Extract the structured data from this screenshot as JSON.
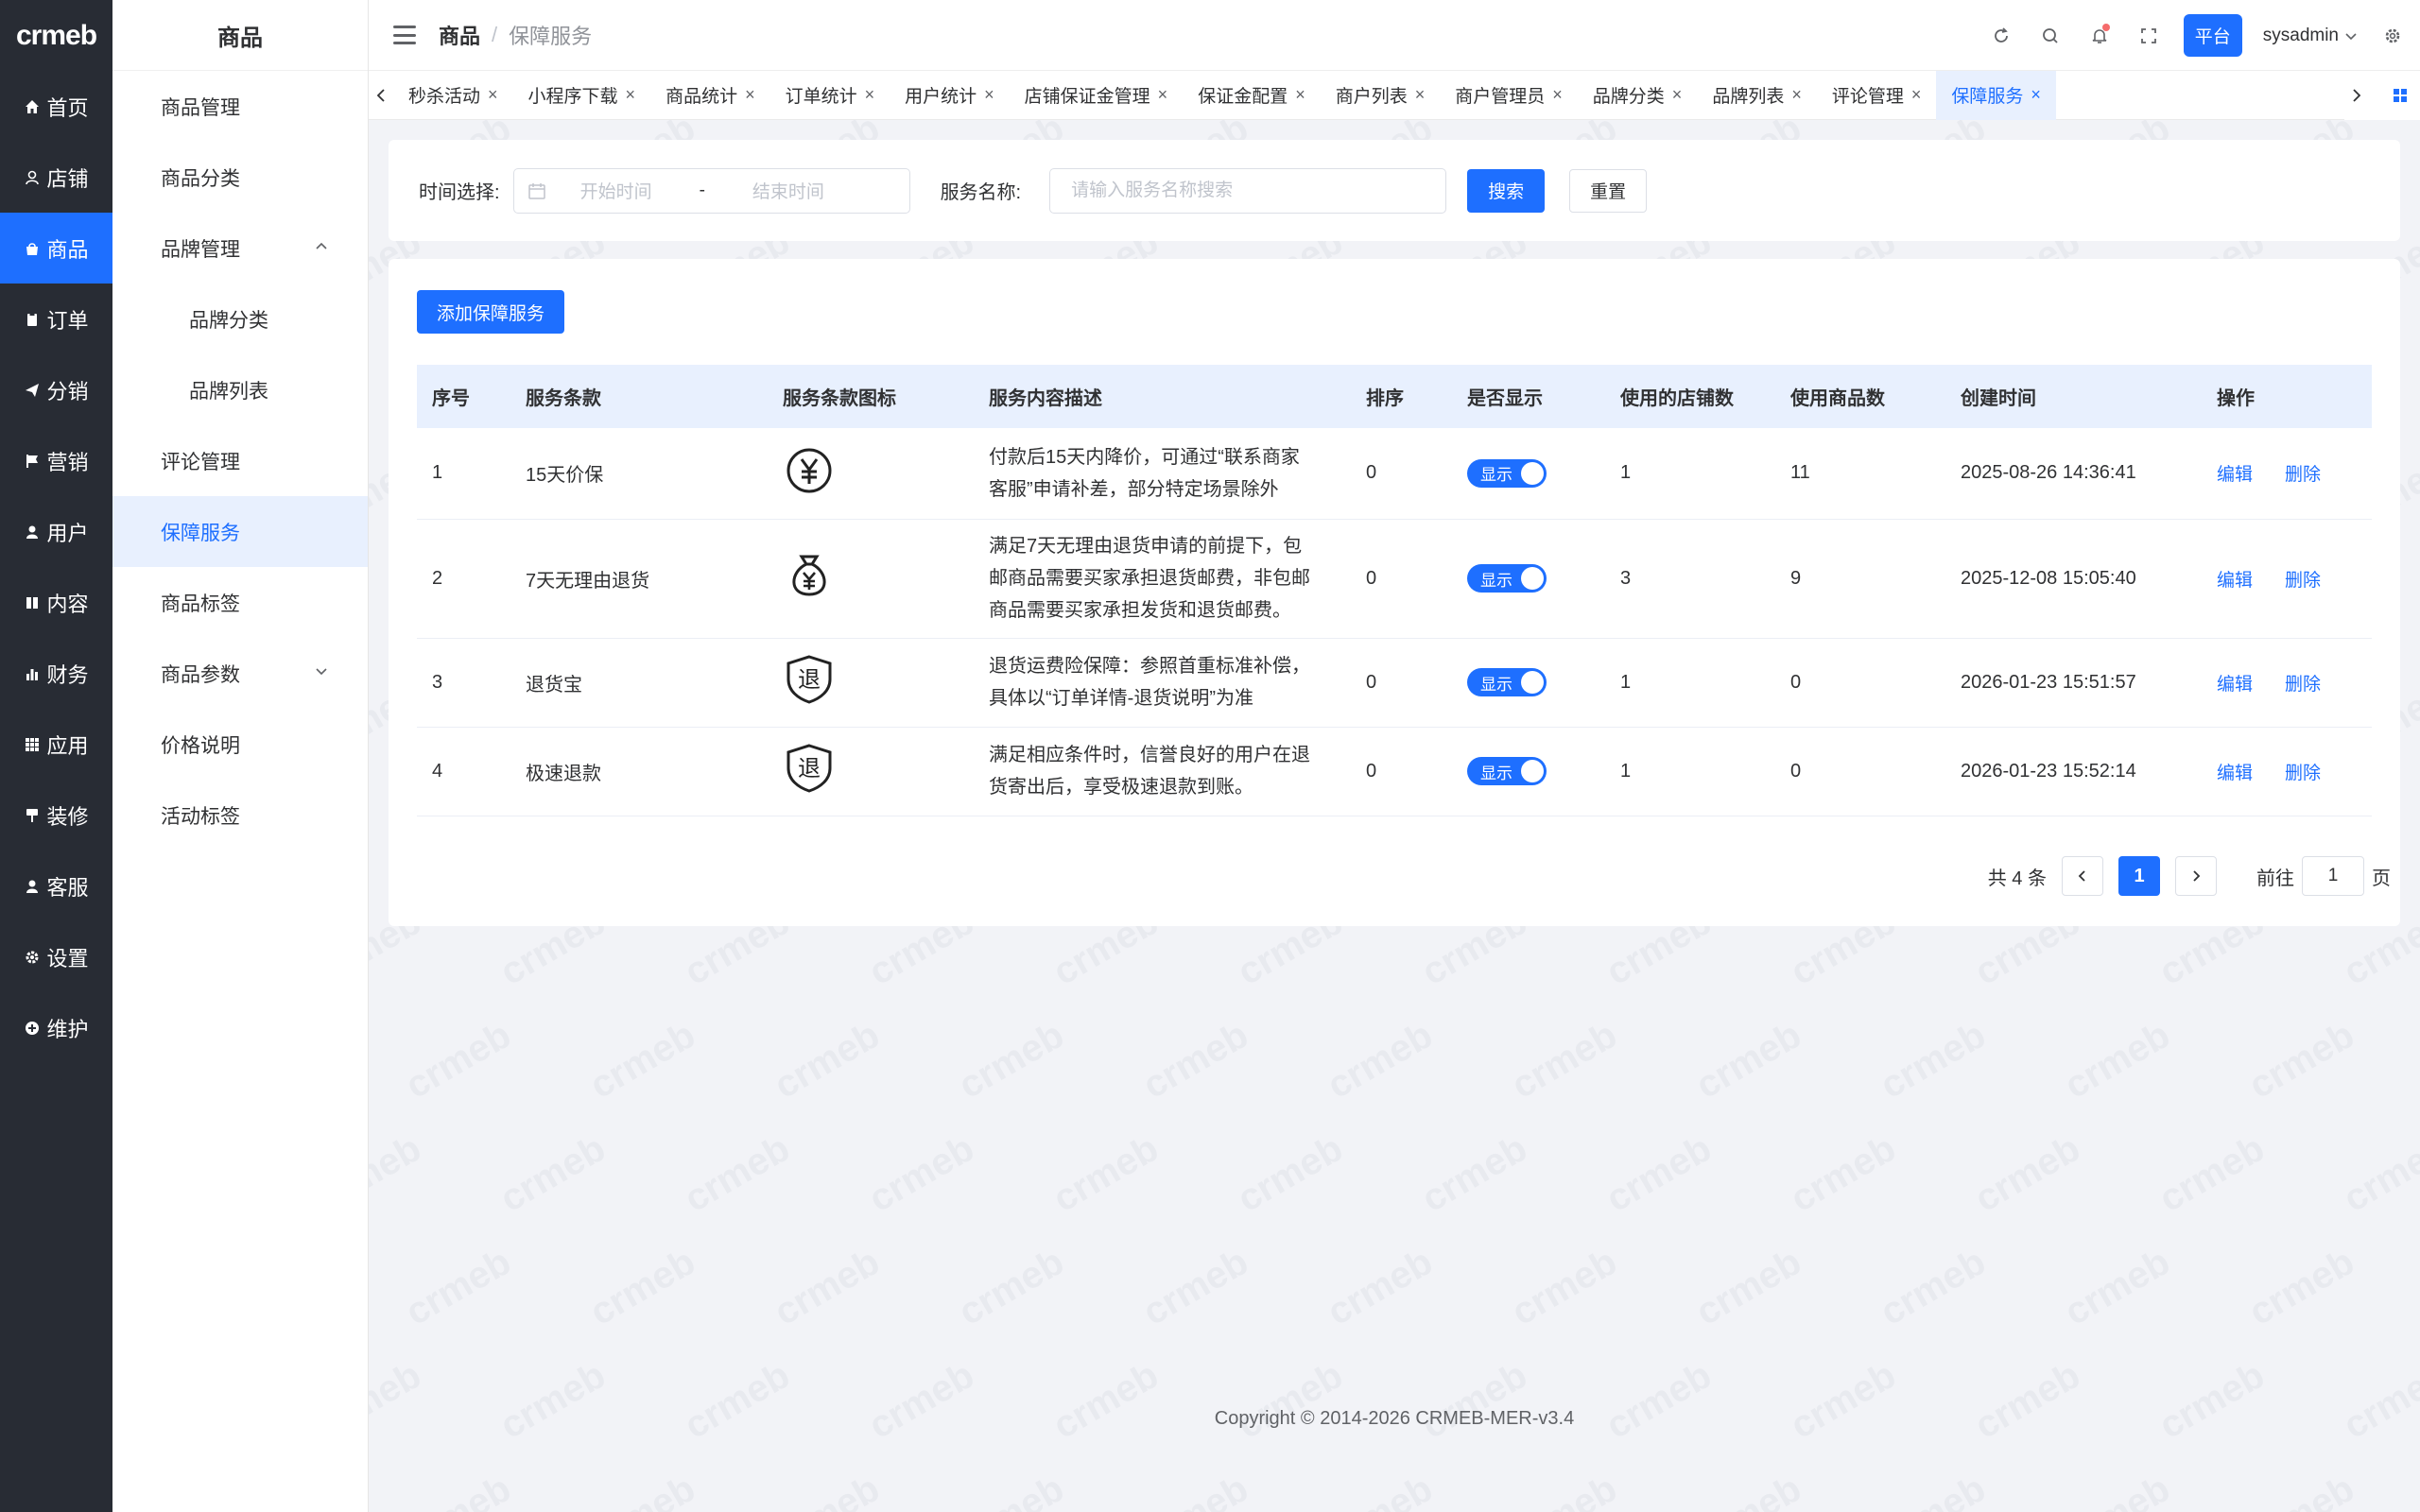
{
  "nav": {
    "logo": "crmeb",
    "items": [
      {
        "label": "首页",
        "icon": "home-icon"
      },
      {
        "label": "店铺",
        "icon": "store-icon"
      },
      {
        "label": "商品",
        "icon": "goods-icon",
        "active": true
      },
      {
        "label": "订单",
        "icon": "order-icon"
      },
      {
        "label": "分销",
        "icon": "distribution-icon"
      },
      {
        "label": "营销",
        "icon": "marketing-icon"
      },
      {
        "label": "用户",
        "icon": "user-icon"
      },
      {
        "label": "内容",
        "icon": "content-icon"
      },
      {
        "label": "财务",
        "icon": "finance-icon"
      },
      {
        "label": "应用",
        "icon": "app-icon"
      },
      {
        "label": "装修",
        "icon": "decoration-icon"
      },
      {
        "label": "客服",
        "icon": "service-icon"
      },
      {
        "label": "设置",
        "icon": "settings-icon"
      },
      {
        "label": "维护",
        "icon": "maintenance-icon"
      }
    ]
  },
  "submenu": {
    "title": "商品",
    "items": [
      {
        "label": "商品管理"
      },
      {
        "label": "商品分类"
      },
      {
        "label": "品牌管理"
      },
      {
        "label": "品牌分类"
      },
      {
        "label": "品牌列表"
      },
      {
        "label": "评论管理"
      },
      {
        "label": "保障服务"
      },
      {
        "label": "商品标签"
      },
      {
        "label": "商品参数"
      },
      {
        "label": "价格说明"
      },
      {
        "label": "活动标签"
      }
    ]
  },
  "header": {
    "breadcrumb_root": "商品",
    "breadcrumb_sep": "/",
    "breadcrumb_current": "保障服务",
    "platform": "平台",
    "username": "sysadmin"
  },
  "tabs": [
    {
      "label": "秒杀活动"
    },
    {
      "label": "小程序下载"
    },
    {
      "label": "商品统计"
    },
    {
      "label": "订单统计"
    },
    {
      "label": "用户统计"
    },
    {
      "label": "店铺保证金管理"
    },
    {
      "label": "保证金配置"
    },
    {
      "label": "商户列表"
    },
    {
      "label": "商户管理员"
    },
    {
      "label": "品牌分类"
    },
    {
      "label": "品牌列表"
    },
    {
      "label": "评论管理"
    },
    {
      "label": "保障服务"
    }
  ],
  "filter": {
    "time_label": "时间选择:",
    "start_placeholder": "开始时间",
    "date_sep": "-",
    "end_placeholder": "结束时间",
    "name_label": "服务名称:",
    "name_placeholder": "请输入服务名称搜索",
    "search": "搜索",
    "reset": "重置"
  },
  "main": {
    "add_button": "添加保障服务",
    "columns": [
      "序号",
      "服务条款",
      "服务条款图标",
      "服务内容描述",
      "排序",
      "是否显示",
      "使用的店铺数",
      "使用商品数",
      "创建时间",
      "操作"
    ],
    "rows": [
      {
        "id": "1",
        "name": "15天价保",
        "icon": "yuan-circle-icon",
        "desc": "付款后15天内降价，可通过“联系商家客服”申请补差，部分特定场景除外",
        "sort": "0",
        "show": "显示",
        "stores": "1",
        "goods": "11",
        "created": "2025-08-26 14:36:41",
        "edit": "编辑",
        "delete": "删除"
      },
      {
        "id": "2",
        "name": "7天无理由退货",
        "icon": "money-bag-icon",
        "desc": "满足7天无理由退货申请的前提下，包邮商品需要买家承担退货邮费，非包邮商品需要买家承担发货和退货邮费。",
        "sort": "0",
        "show": "显示",
        "stores": "3",
        "goods": "9",
        "created": "2025-12-08 15:05:40",
        "edit": "编辑",
        "delete": "删除"
      },
      {
        "id": "3",
        "name": "退货宝",
        "icon": "return-shield-icon",
        "icon_text": "退",
        "desc": "退货运费险保障：参照首重标准补偿，具体以“订单详情-退货说明”为准",
        "sort": "0",
        "show": "显示",
        "stores": "1",
        "goods": "0",
        "created": "2026-01-23 15:51:57",
        "edit": "编辑",
        "delete": "删除"
      },
      {
        "id": "4",
        "name": "极速退款",
        "icon": "return-shield-icon",
        "icon_text": "退",
        "desc": "满足相应条件时，信誉良好的用户在退货寄出后，享受极速退款到账。",
        "sort": "0",
        "show": "显示",
        "stores": "1",
        "goods": "0",
        "created": "2026-01-23 15:52:14",
        "edit": "编辑",
        "delete": "删除"
      }
    ]
  },
  "pager": {
    "total": "共 4 条",
    "current": "1",
    "goto": "前往",
    "goto_value": "1",
    "page_unit": "页"
  },
  "copyright": "Copyright © 2014-2026 CRMEB-MER-v3.4",
  "watermark": "crmeb",
  "colors": {
    "accent": "#1e6fff",
    "nav_bg": "#282c34"
  }
}
